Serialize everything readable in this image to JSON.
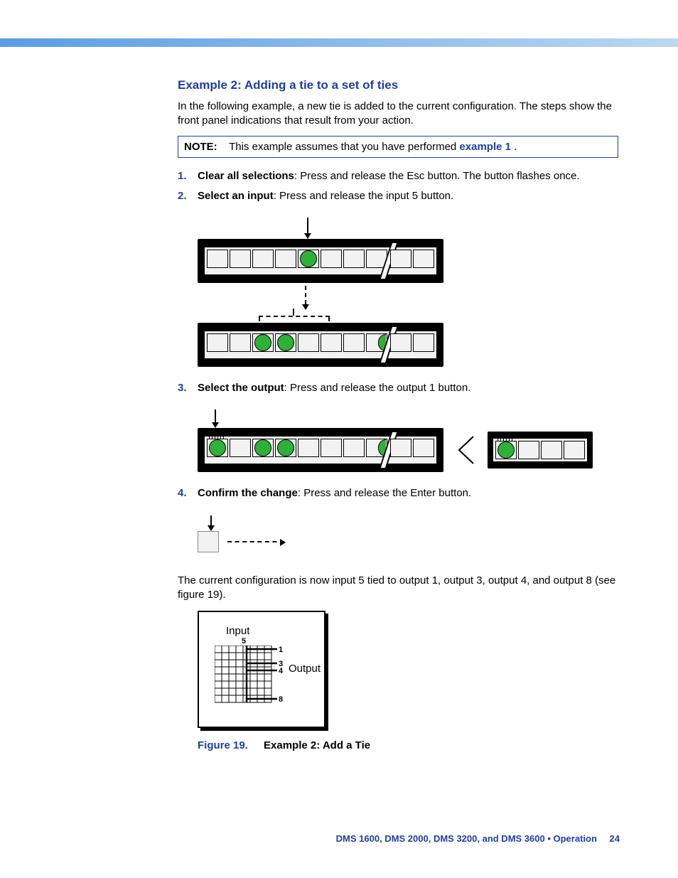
{
  "heading": "Example 2: Adding a tie to a set of ties",
  "intro": "In the following example, a new tie is added to the current configuration. The steps show the front panel indications that result from your action.",
  "note": {
    "label": "NOTE:",
    "text": "This example assumes that you have performed ",
    "link": "example 1",
    "tail": "."
  },
  "steps": [
    {
      "num": "1.",
      "strong": "Clear all selections",
      "rest": ": Press and release the Esc button. The button flashes once."
    },
    {
      "num": "2.",
      "strong": "Select an input",
      "rest": ": Press and release the input 5 button."
    },
    {
      "num": "3.",
      "strong": "Select the output",
      "rest": ": Press and release the output 1 button."
    },
    {
      "num": "4.",
      "strong": "Confirm the change",
      "rest": ": Press and release the Enter button."
    }
  ],
  "result_para": "The current configuration is now input 5 tied to output 1, output 3, output 4, and output 8 (see figure 19).",
  "figure": {
    "label": "Figure 19.",
    "title": "Example 2: Add a Tie",
    "input_label": "Input",
    "output_label": "Output",
    "input_col": "5",
    "output_rows": [
      "1",
      "3",
      "4",
      "8"
    ]
  },
  "footer": {
    "text": "DMS 1600, DMS 2000, DMS 3200, and DMS 3600 • Operation",
    "page": "24"
  }
}
